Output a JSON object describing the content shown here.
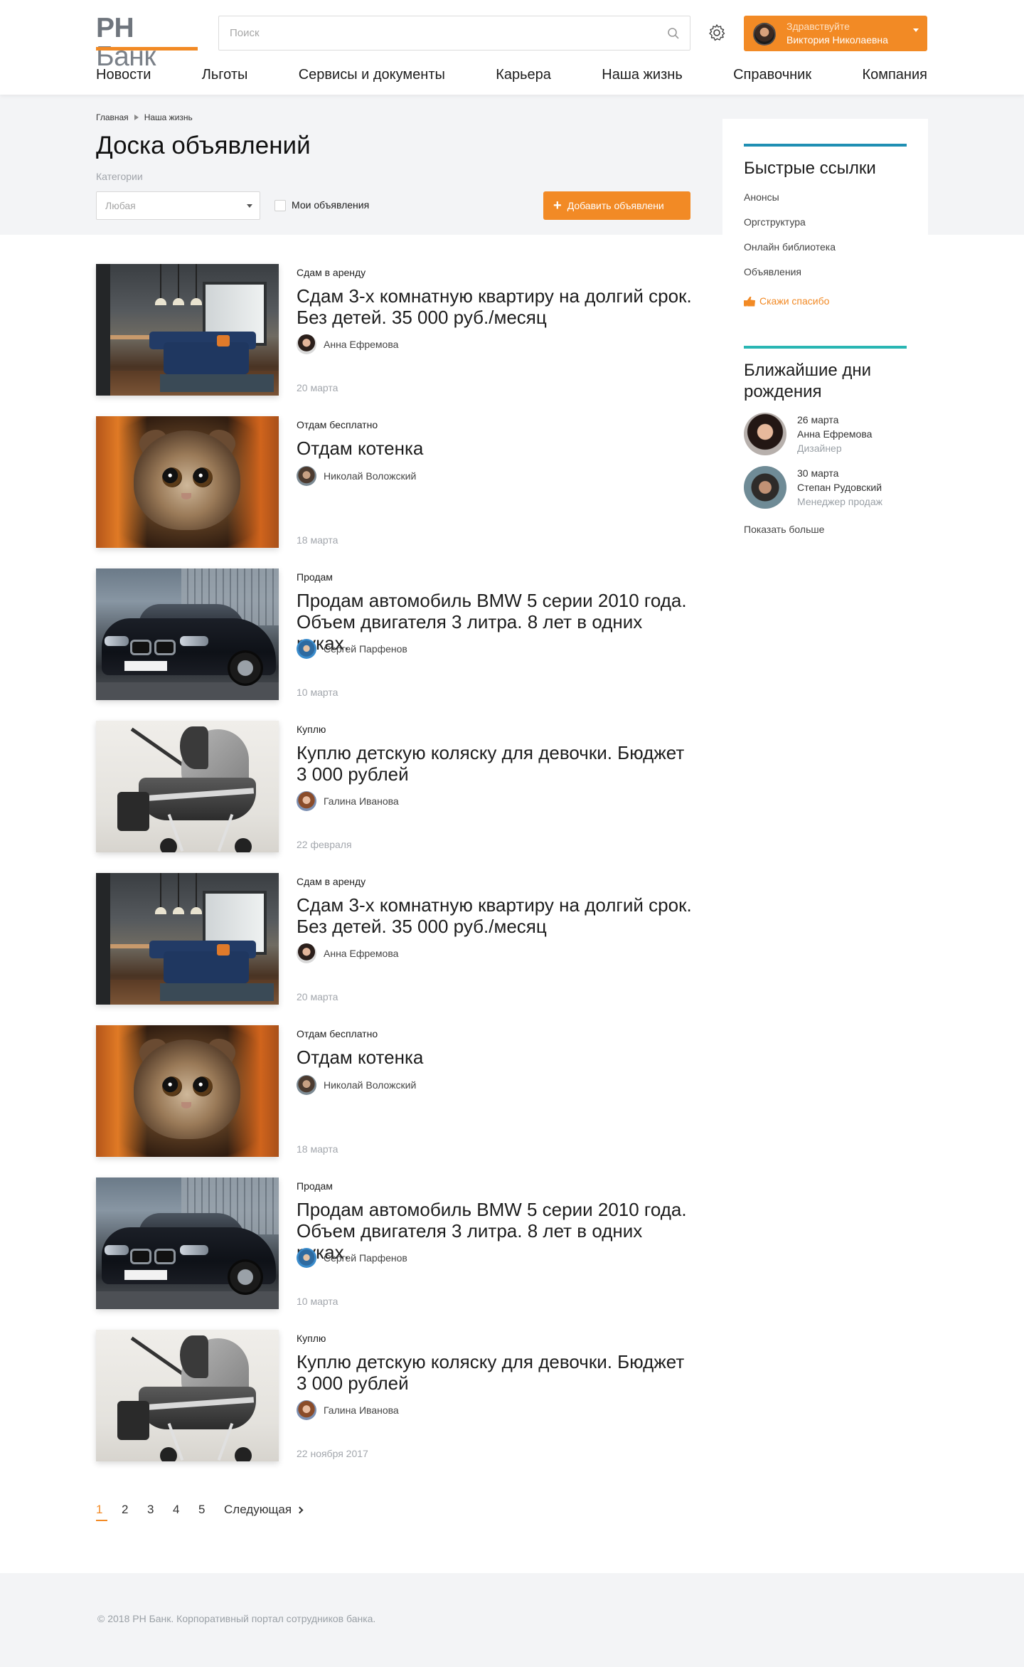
{
  "header": {
    "logo_bold": "РН",
    "logo_rest": "Банк",
    "search_placeholder": "Поиск",
    "user_greeting": "Здравствуйте",
    "user_name": "Виктория Николаевна",
    "nav": [
      "Новости",
      "Льготы",
      "Сервисы и документы",
      "Карьера",
      "Наша жизнь",
      "Справочник",
      "Компания"
    ]
  },
  "breadcrumbs": [
    "Главная",
    "Наша жизнь"
  ],
  "page_title": "Доска объявлений",
  "filters": {
    "category_label": "Категории",
    "category_value": "Любая",
    "my_ads_label": "Мои объявления",
    "add_button": "Добавить объявлени"
  },
  "listings": [
    {
      "category": "Сдам в аренду",
      "title": "Сдам 3-х комнатную квартиру на долгий срок. Без детей. 35 000 руб./месяц",
      "author": "Анна Ефремова",
      "date": "20 марта"
    },
    {
      "category": "Отдам бесплатно",
      "title": "Отдам котенка",
      "author": "Николай Воложский",
      "date": "18 марта"
    },
    {
      "category": "Продам",
      "title": "Продам автомобиль BMW 5 серии 2010 года. Объем двигателя 3 литра. 8 лет в одних руках.",
      "author": "Сергей Парфенов",
      "date": "10 марта"
    },
    {
      "category": "Куплю",
      "title": "Куплю детскую коляску для девочки. Бюджет 3 000 рублей",
      "author": "Галина Иванова",
      "date": "22 февраля"
    },
    {
      "category": "Сдам в аренду",
      "title": "Сдам 3-х комнатную квартиру на долгий срок. Без детей. 35 000 руб./месяц",
      "author": "Анна Ефремова",
      "date": "20 марта"
    },
    {
      "category": "Отдам бесплатно",
      "title": "Отдам котенка",
      "author": "Николай Воложский",
      "date": "18 марта"
    },
    {
      "category": "Продам",
      "title": "Продам автомобиль BMW 5 серии 2010 года. Объем двигателя 3 литра. 8 лет в одних руках.",
      "author": "Сергей Парфенов",
      "date": "10 марта"
    },
    {
      "category": "Куплю",
      "title": "Куплю детскую коляску для девочки. Бюджет 3 000 рублей",
      "author": "Галина Иванова",
      "date": "22 ноября 2017"
    }
  ],
  "pagination": {
    "pages": [
      "1",
      "2",
      "3",
      "4",
      "5"
    ],
    "current": "1",
    "next": "Следующая"
  },
  "sidebar": {
    "quick_links_title": "Быстрые ссылки",
    "quick_links": [
      "Анонсы",
      "Оргструктура",
      "Онлайн библиотека",
      "Объявления"
    ],
    "thanks_link": "Скажи спасибо",
    "birthdays_title": "Ближайшие дни рождения",
    "birthdays": [
      {
        "date": "26 марта",
        "name": "Анна Ефремова",
        "role": "Дизайнер"
      },
      {
        "date": "30 марта",
        "name": "Степан Рудовский",
        "role": "Менеджер продаж"
      }
    ],
    "show_more": "Показать больше"
  },
  "footer": "© 2018 РН Банк. Корпоративный портал сотрудников банка.",
  "colors": {
    "accent": "#f28a25",
    "quick_links_line": "#1f8fb3",
    "birthdays_line": "#29b6b3",
    "band_bg": "#f3f4f6"
  }
}
